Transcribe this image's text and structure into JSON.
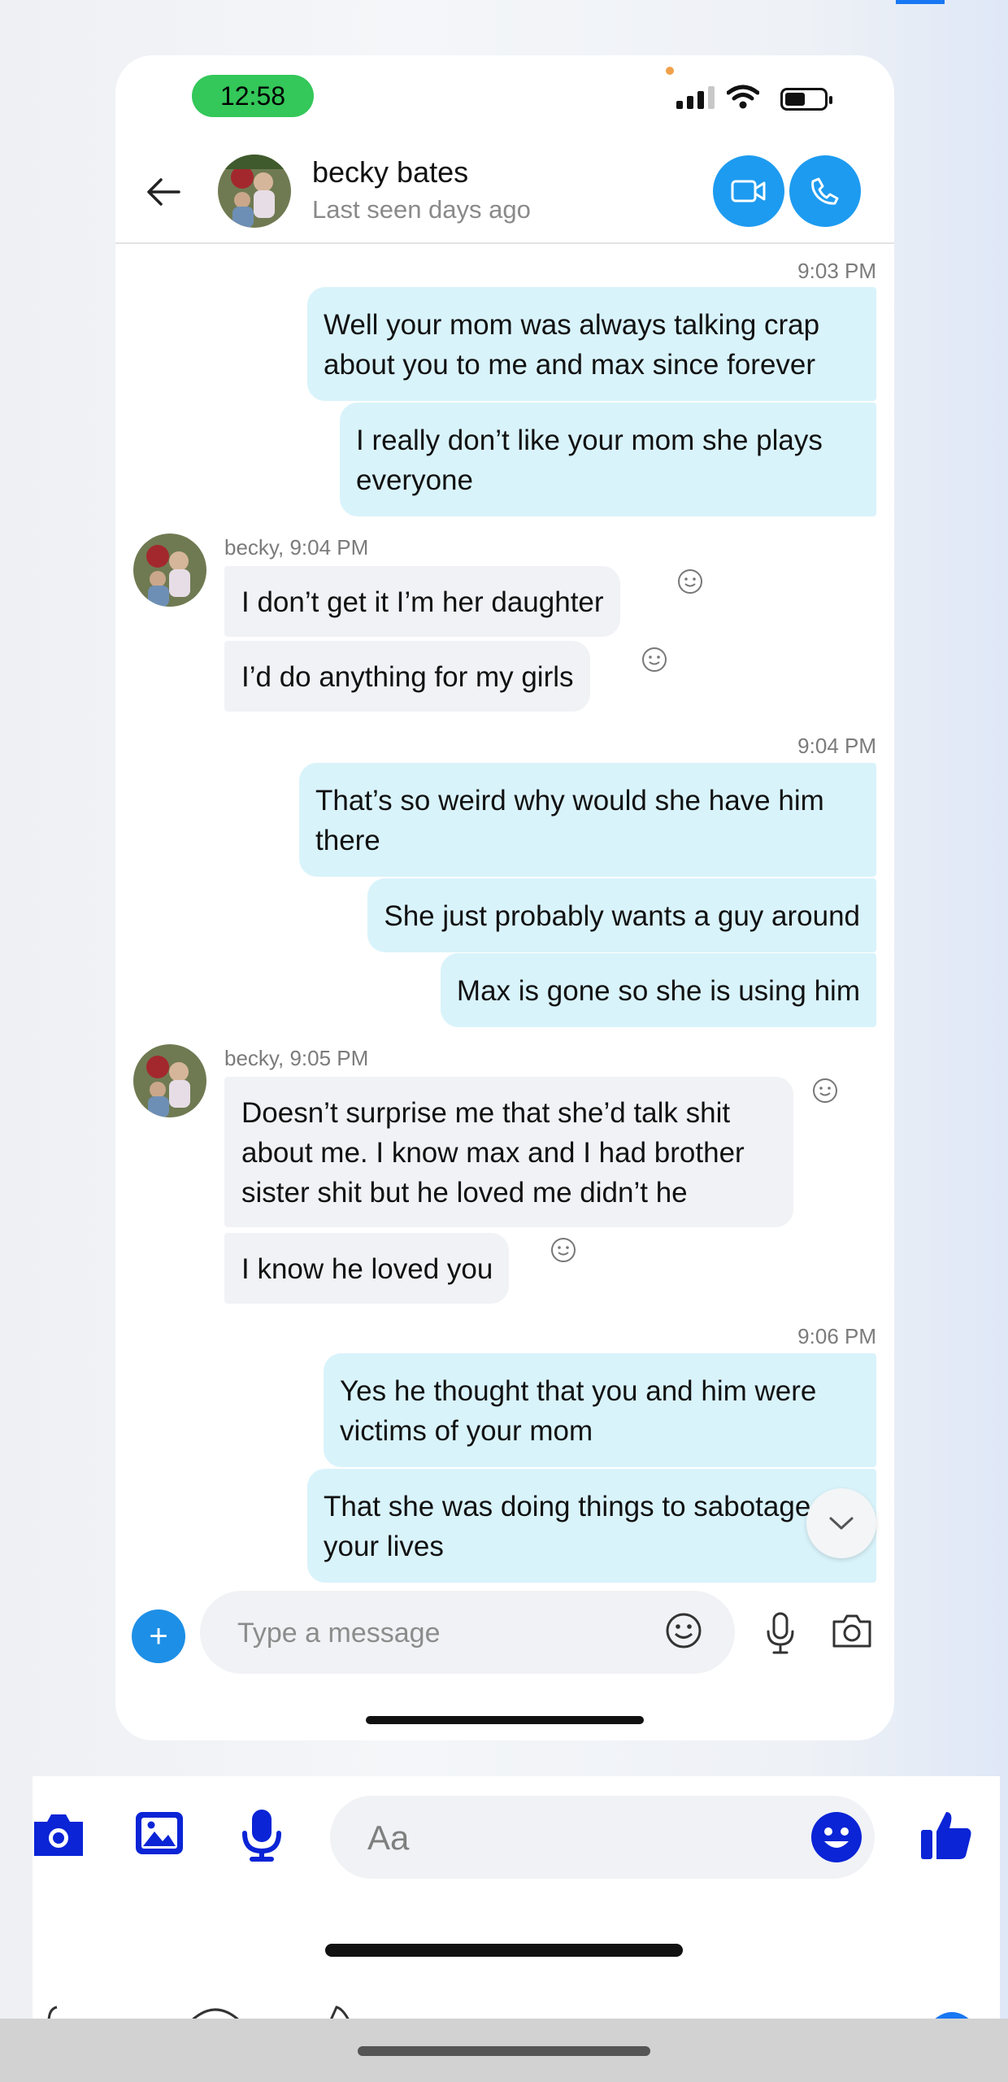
{
  "status_bar": {
    "time": "12:58"
  },
  "header": {
    "name": "becky bates",
    "status": "Last seen days ago"
  },
  "messages": {
    "group1": {
      "time": "9:03 PM",
      "m1": "Well your mom was always talking crap about you to me and max since forever",
      "m2": "I really don’t like your mom she plays everyone"
    },
    "group2": {
      "sender": "becky, 9:04 PM",
      "m1": "I don’t get it I’m her daughter",
      "m2": "I’d do anything for my girls"
    },
    "group3": {
      "time": "9:04 PM",
      "m1": "That’s so weird why would she have him there",
      "m2": "She just probably wants a guy around",
      "m3": "Max is gone so she is using him"
    },
    "group4": {
      "sender": "becky, 9:05 PM",
      "m1": "Doesn’t surprise me that she’d talk shit about me. I know max and I had brother sister shit but he loved me didn’t he",
      "m2": "I know he loved you"
    },
    "group5": {
      "time": "9:06 PM",
      "m1": "Yes he thought that you and him were victims of your mom",
      "m2": "That she was doing things to sabotage your lives"
    }
  },
  "composer": {
    "placeholder": "Type a message",
    "plus_label": "+"
  },
  "outer_composer": {
    "placeholder": "Aa"
  },
  "colors": {
    "accent": "#1d9bf0",
    "outgoing_bubble": "#d9f3fb",
    "incoming_bubble": "#f1f2f6",
    "messenger_blue": "#0a24d6"
  },
  "icons": [
    "back-arrow-icon",
    "video-call-icon",
    "phone-call-icon",
    "smiley-react-icon",
    "chevron-down-icon",
    "emoji-icon",
    "microphone-icon",
    "camera-icon",
    "image-icon",
    "thumbs-up-icon"
  ]
}
